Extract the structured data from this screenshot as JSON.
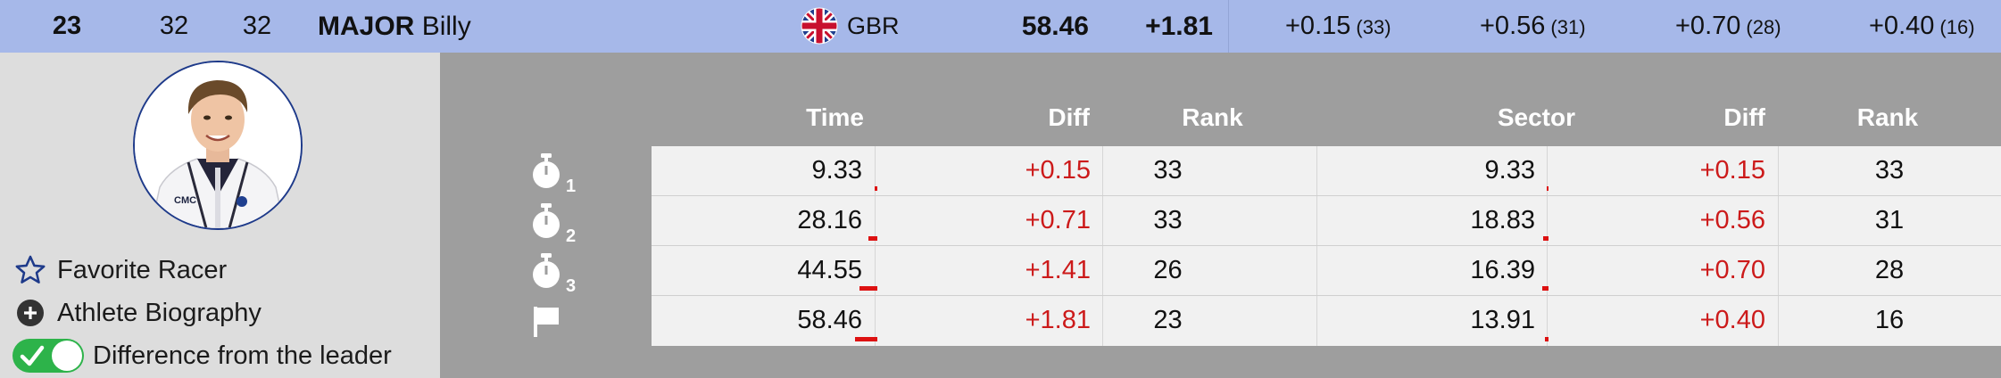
{
  "athlete": {
    "rank": "23",
    "bib": "32",
    "start_no": "32",
    "last_name": "MAJOR",
    "first_name": "Billy",
    "nation": "GBR",
    "total_time": "58.46",
    "total_diff": "+1.81",
    "photo_jacket_text": "CMC"
  },
  "header_splits": [
    {
      "diff": "+0.15",
      "rank": "(33)"
    },
    {
      "diff": "+0.56",
      "rank": "(31)"
    },
    {
      "diff": "+0.70",
      "rank": "(28)"
    },
    {
      "diff": "+0.40",
      "rank": "(16)"
    }
  ],
  "actions": {
    "favorite": "Favorite Racer",
    "biography": "Athlete Biography",
    "difference": "Difference from the leader",
    "difference_enabled": true
  },
  "columns": {
    "time": "Time",
    "diff": "Diff",
    "rank": "Rank",
    "sector": "Sector",
    "sector_diff": "Diff",
    "sector_rank": "Rank"
  },
  "rows": [
    {
      "subscript": "1",
      "icon": "stopwatch-icon",
      "time": "9.33",
      "diff": "+0.15",
      "rank": "33",
      "sector": "9.33",
      "sector_diff": "+0.15",
      "sector_rank": "33"
    },
    {
      "subscript": "2",
      "icon": "stopwatch-icon",
      "time": "28.16",
      "diff": "+0.71",
      "rank": "33",
      "sector": "18.83",
      "sector_diff": "+0.56",
      "sector_rank": "31"
    },
    {
      "subscript": "3",
      "icon": "stopwatch-icon",
      "time": "44.55",
      "diff": "+1.41",
      "rank": "26",
      "sector": "16.39",
      "sector_diff": "+0.70",
      "sector_rank": "28"
    },
    {
      "subscript": "",
      "icon": "finish-flag-icon",
      "time": "58.46",
      "diff": "+1.81",
      "rank": "23",
      "sector": "13.91",
      "sector_diff": "+0.40",
      "sector_rank": "16"
    }
  ],
  "colors": {
    "header_bg": "#a6b8e9",
    "panel_bg": "#9e9e9e",
    "diff_red": "#cc1a1a",
    "toggle_green": "#2db34a"
  }
}
